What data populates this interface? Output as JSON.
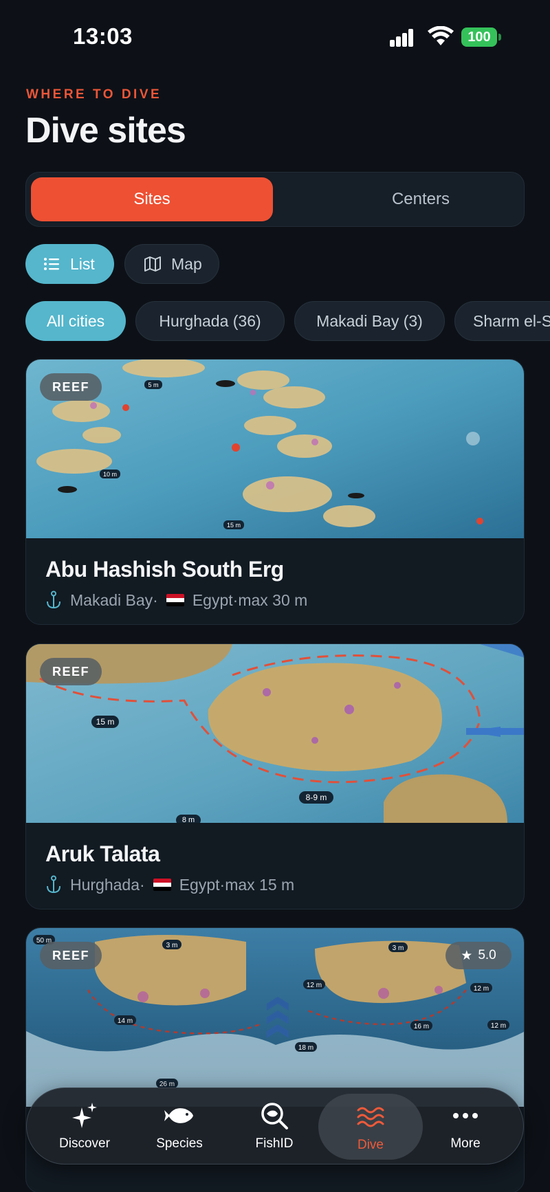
{
  "status_bar": {
    "time": "13:03",
    "battery": "100"
  },
  "header": {
    "eyebrow": "WHERE TO DIVE",
    "title": "Dive sites"
  },
  "segmented": {
    "sites": "Sites",
    "centers": "Centers"
  },
  "view_toggle": {
    "list": "List",
    "map": "Map"
  },
  "city_filters": [
    "All cities",
    "Hurghada (36)",
    "Makadi Bay (3)",
    "Sharm el-S"
  ],
  "sites": [
    {
      "badge": "REEF",
      "name": "Abu Hashish South Erg",
      "city": "Makadi Bay",
      "country": "Egypt",
      "max_depth": "max 30 m",
      "depth_labels": [
        "5 m",
        "10 m",
        "15 m"
      ]
    },
    {
      "badge": "REEF",
      "name": "Aruk Talata",
      "city": "Hurghada",
      "country": "Egypt",
      "max_depth": "max 15 m",
      "depth_labels": [
        "15 m",
        "8-9 m",
        "8 m"
      ]
    },
    {
      "badge": "REEF",
      "rating": "5.0",
      "depth_labels": [
        "50 m",
        "3 m",
        "3 m",
        "12 m",
        "12 m",
        "14 m",
        "18 m",
        "16 m",
        "12 m",
        "26 m"
      ]
    }
  ],
  "meta_separator": " · ",
  "tabbar": {
    "discover": "Discover",
    "species": "Species",
    "fishid": "FishID",
    "dive": "Dive",
    "more": "More"
  },
  "colors": {
    "accent": "#ee5033",
    "teal": "#55b6cc",
    "background": "#0d1117"
  },
  "icons": [
    "signal-icon",
    "wifi-icon",
    "battery-icon",
    "list-icon",
    "map-icon",
    "anchor-icon",
    "egypt-flag-icon",
    "star-icon",
    "sparkles-icon",
    "fish-icon",
    "magnify-fish-icon",
    "waves-icon",
    "more-dots-icon"
  ]
}
